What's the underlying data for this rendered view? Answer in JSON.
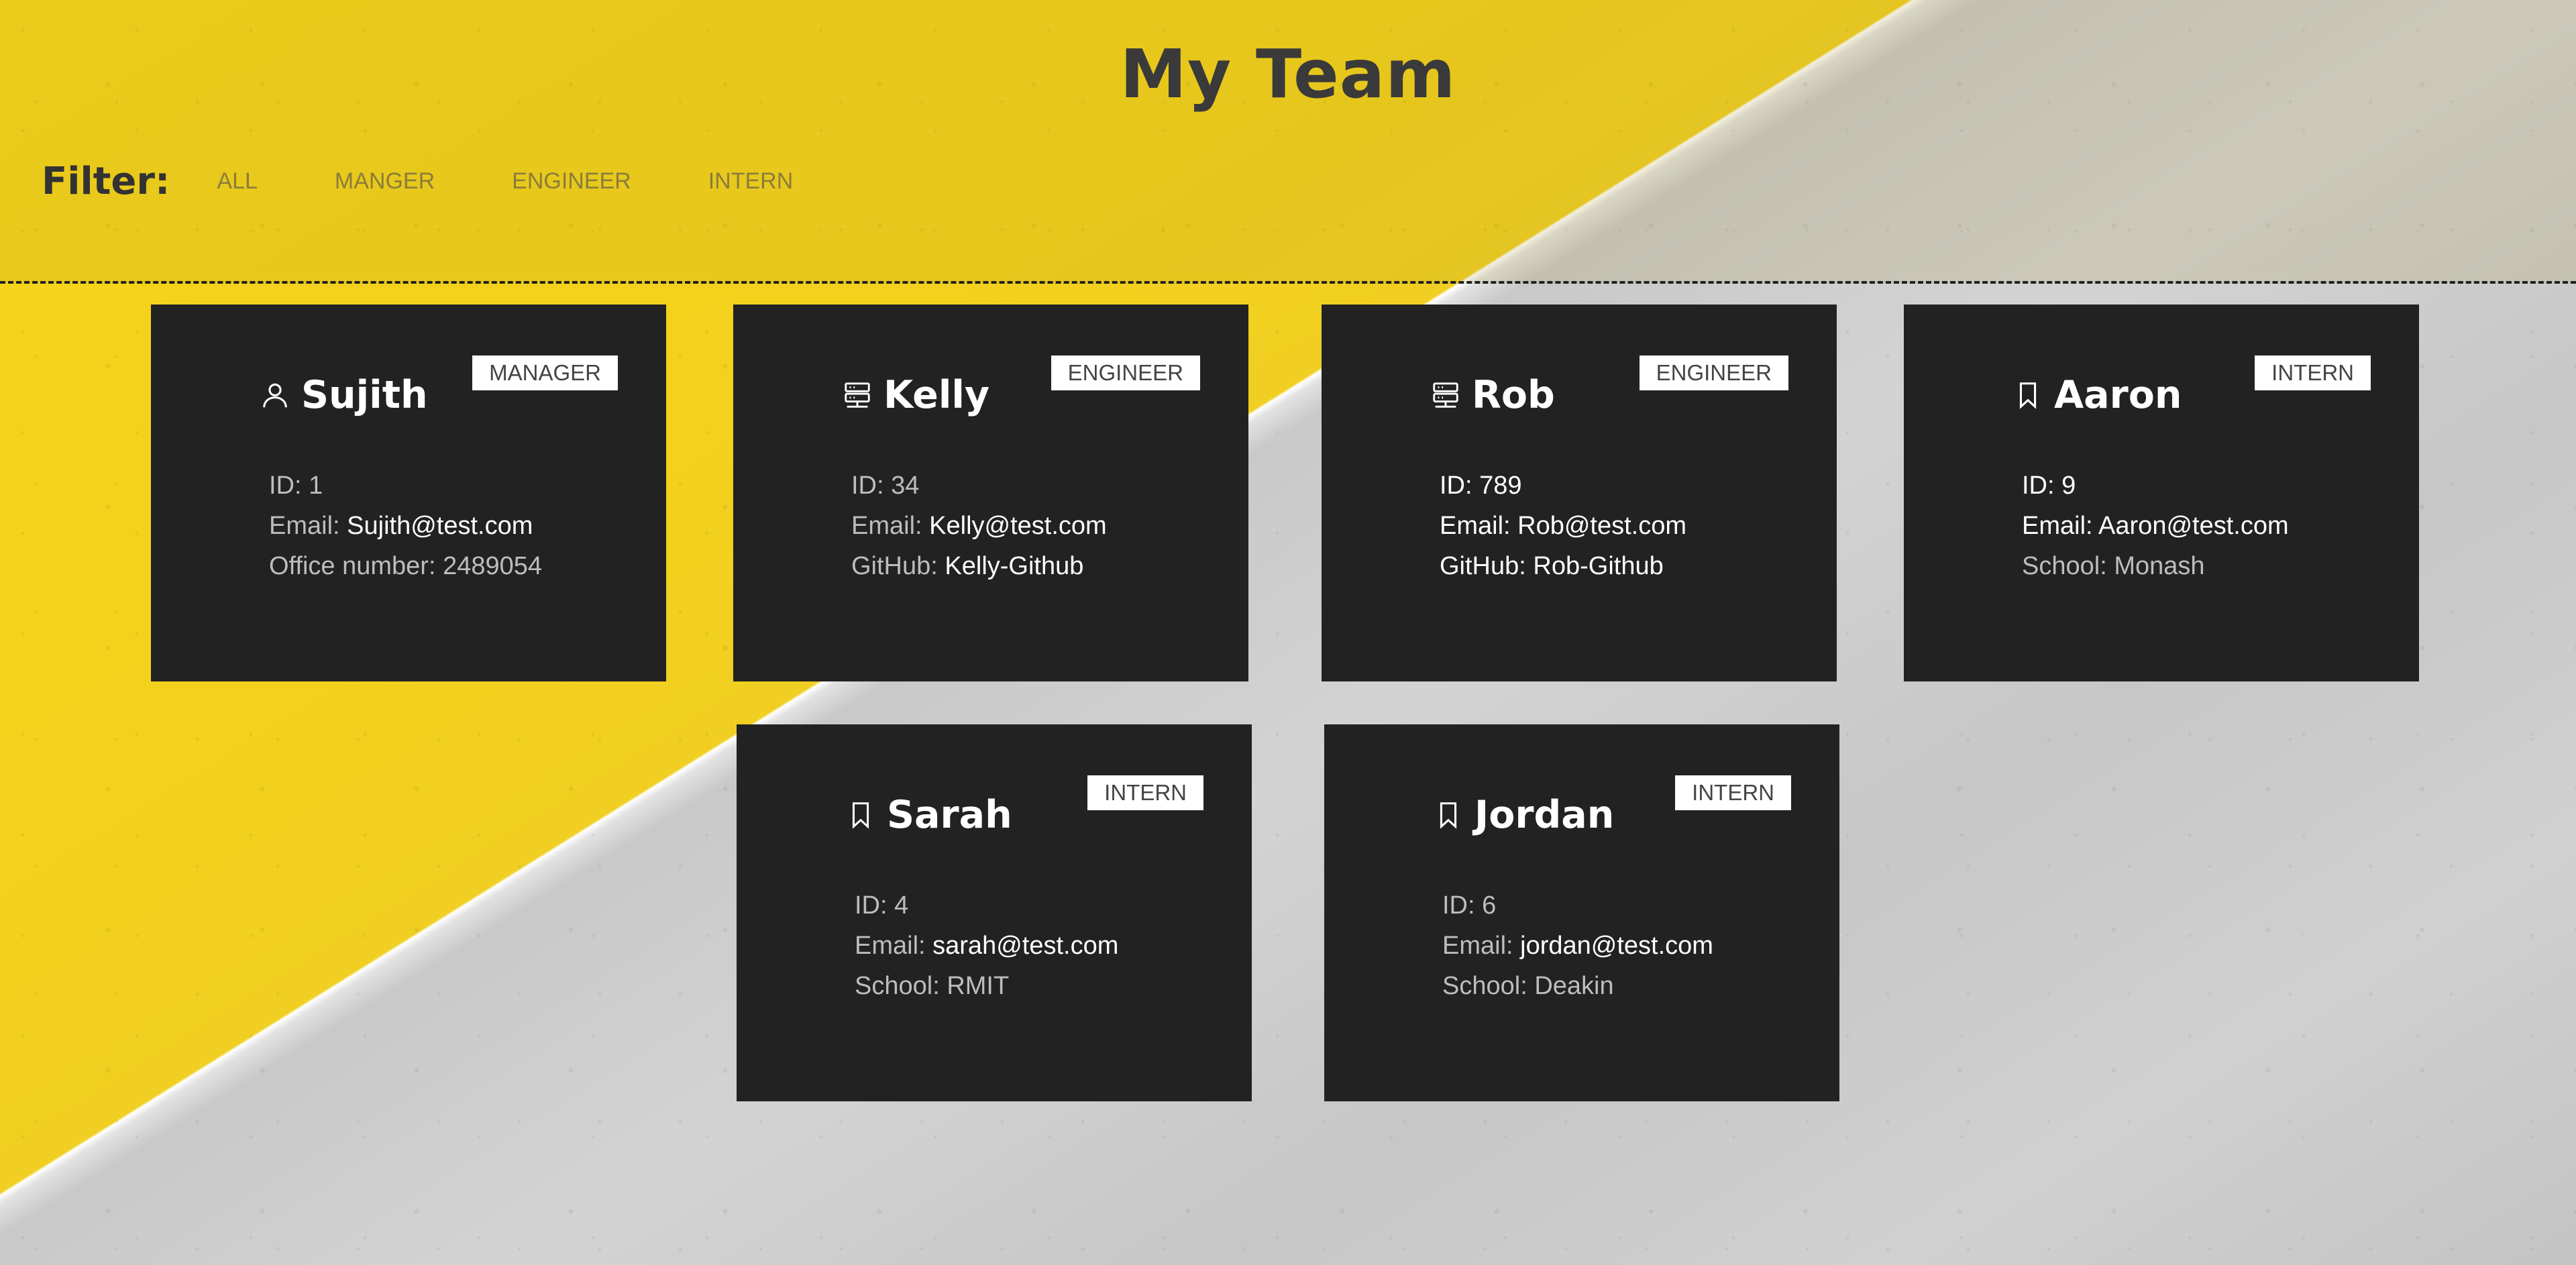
{
  "page": {
    "title": "My Team"
  },
  "filter": {
    "label": "Filter:",
    "options": [
      "ALL",
      "MANGER",
      "ENGINEER",
      "INTERN"
    ]
  },
  "colors": {
    "card_background": "#222222",
    "badge_background": "#ffffff",
    "yellow_background": "#f3d11c",
    "concrete_background": "#cccccc"
  },
  "cards": [
    {
      "name": "Sujith",
      "role_badge": "MANAGER",
      "icon": "user-icon",
      "id_label": "ID:",
      "id_value": "1",
      "email_label": "Email:",
      "email_value": "Sujith@test.com",
      "extra_label": "Office number:",
      "extra_value": "2489054"
    },
    {
      "name": "Kelly",
      "role_badge": "ENGINEER",
      "icon": "server-icon",
      "id_label": "ID:",
      "id_value": "34",
      "email_label": "Email:",
      "email_value": "Kelly@test.com",
      "extra_label": "GitHub:",
      "extra_value": "Kelly-Github"
    },
    {
      "name": "Rob",
      "role_badge": "ENGINEER",
      "icon": "server-icon",
      "id_label": "ID:",
      "id_value": "789",
      "email_label": "Email:",
      "email_value": "Rob@test.com",
      "extra_label": "GitHub:",
      "extra_value": "Rob-Github"
    },
    {
      "name": "Aaron",
      "role_badge": "INTERN",
      "icon": "bookmark-icon",
      "id_label": "ID:",
      "id_value": "9",
      "email_label": "Email:",
      "email_value": "Aaron@test.com",
      "extra_label": "School:",
      "extra_value": "Monash"
    },
    {
      "name": "Sarah",
      "role_badge": "INTERN",
      "icon": "bookmark-icon",
      "id_label": "ID:",
      "id_value": "4",
      "email_label": "Email:",
      "email_value": "sarah@test.com",
      "extra_label": "School:",
      "extra_value": "RMIT"
    },
    {
      "name": "Jordan",
      "role_badge": "INTERN",
      "icon": "bookmark-icon",
      "id_label": "ID:",
      "id_value": "6",
      "email_label": "Email:",
      "email_value": "jordan@test.com",
      "extra_label": "School:",
      "extra_value": "Deakin"
    }
  ]
}
